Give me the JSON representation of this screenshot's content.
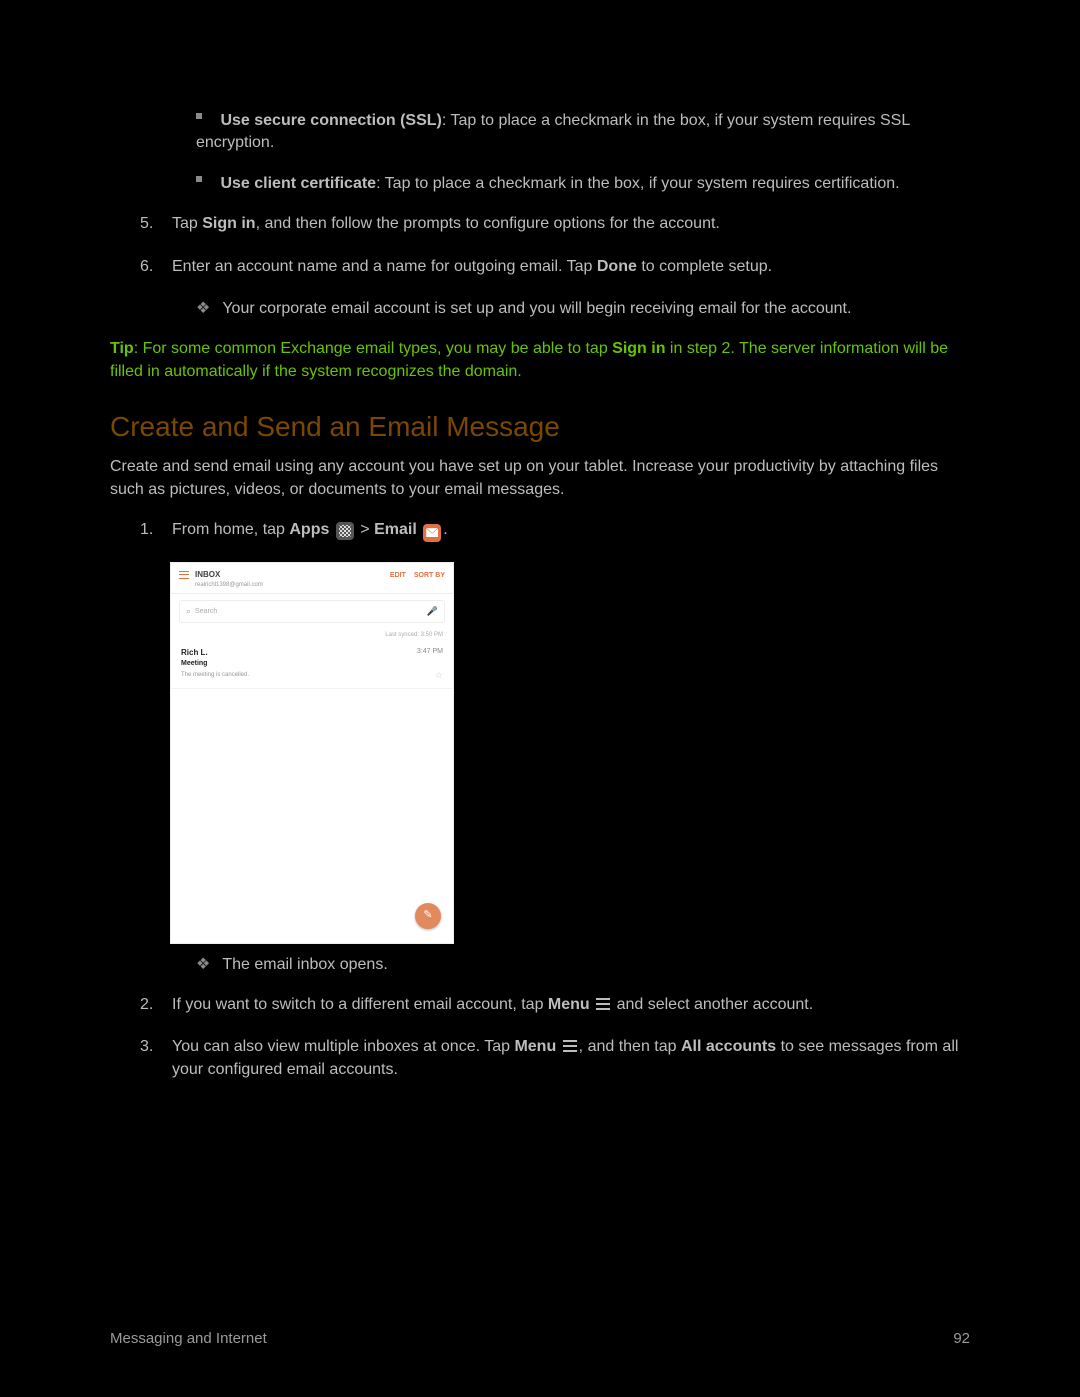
{
  "bullets": {
    "ssl_bold": "Use secure connection (SSL)",
    "ssl_text": ": Tap to place a checkmark in the box, if your system requires SSL encryption.",
    "cert_bold": "Use client certificate",
    "cert_text": ": Tap to place a checkmark in the box, if your system requires certification."
  },
  "steps_a": {
    "five_num": "5.",
    "five_pre": "Tap ",
    "five_bold": "Sign in",
    "five_post": ", and then follow the prompts to configure options for the account.",
    "six_num": "6.",
    "six_pre": "Enter an account name and a name for outgoing email. Tap ",
    "six_bold": "Done",
    "six_post": " to complete setup.",
    "six_result": "Your corporate email account is set up and you will begin receiving email for the account."
  },
  "tip": {
    "label": "Tip",
    "pre": ": For some common Exchange email types, you may be able to tap ",
    "bold": "Sign in",
    "post": " in step 2. The server information will be filled in automatically if the system recognizes the domain."
  },
  "section_title": "Create and Send an Email Message",
  "intro": "Create and send email using any account you have set up on your tablet. Increase your productivity by attaching files such as pictures, videos, or documents to your email messages.",
  "steps_b": {
    "one_num": "1.",
    "one_pre": "From home, tap ",
    "one_apps": "Apps",
    "one_gt": " > ",
    "one_email": "Email",
    "one_period": ".",
    "one_result": "The email inbox opens.",
    "two_num": "2.",
    "two_pre": "If you want to switch to a different email account, tap ",
    "two_bold": "Menu",
    "two_post": " and select another account.",
    "three_num": "3.",
    "three_pre": "You can also view multiple inboxes at once. Tap ",
    "three_bold1": "Menu",
    "three_mid": ", and then tap ",
    "three_bold2": "All accounts",
    "three_post": " to see messages from all your configured email accounts."
  },
  "mock": {
    "inbox_label": "INBOX",
    "account_email": "realrichl1398@gmail.com",
    "edit": "EDIT",
    "sort": "SORT BY",
    "search_placeholder": "Search",
    "last_sync": "Last synced: 3:50 PM",
    "sender": "Rich L.",
    "time": "3:47 PM",
    "subject": "Meeting",
    "preview": "The meeting is cancelled."
  },
  "footer": {
    "left": "Messaging and Internet",
    "right": "92"
  }
}
